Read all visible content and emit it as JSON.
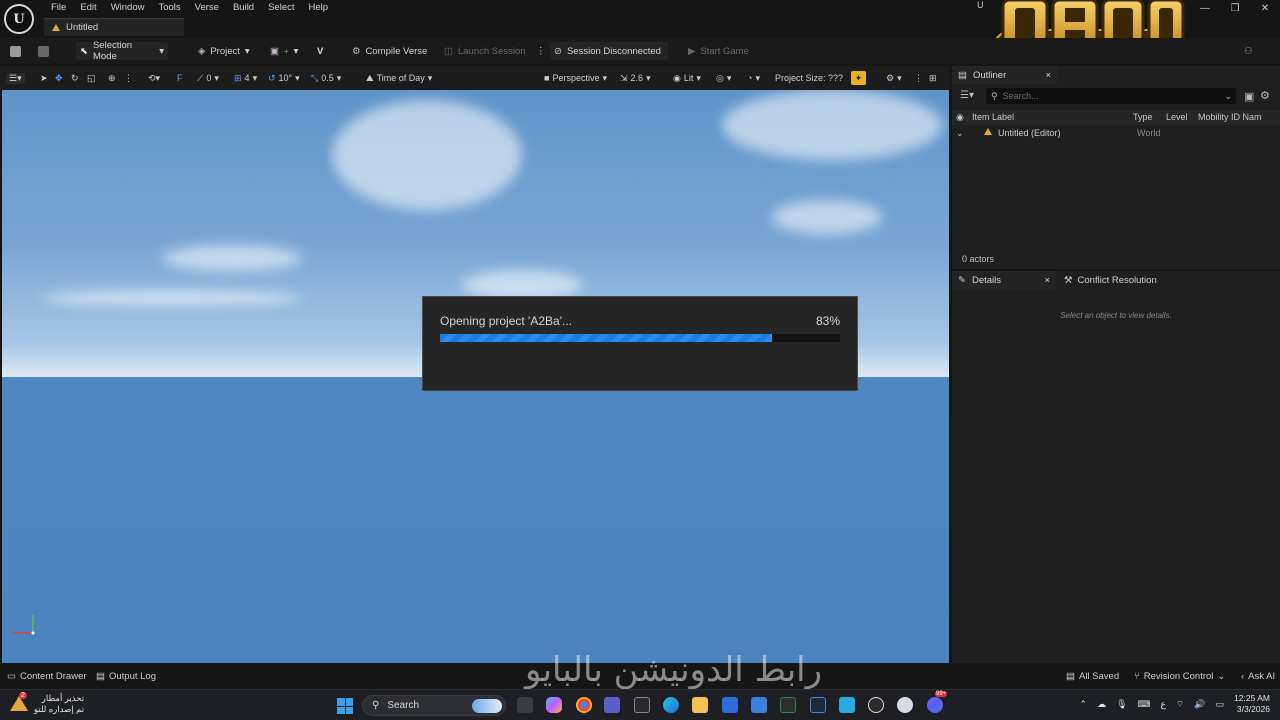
{
  "window": {
    "menu": [
      "File",
      "Edit",
      "Window",
      "Tools",
      "Verse",
      "Build",
      "Select",
      "Help"
    ],
    "doc_tab": "Untitled",
    "corner_letter": "U",
    "controls": [
      "—",
      "❐",
      "✕"
    ]
  },
  "toolbar": {
    "selection_mode": "Selection Mode",
    "project": "Project",
    "compile_verse": "Compile Verse",
    "launch_session": "Launch Session",
    "session_status": "Session Disconnected",
    "start_game": "Start Game"
  },
  "viewport_toolbar": {
    "snap_count": "0",
    "grid_snap": "4",
    "rotation_snap": "10°",
    "scale_snap": "0.5",
    "time_of_day": "Time of Day",
    "perspective": "Perspective",
    "camera_speed": "2.6",
    "lit": "Lit",
    "project_size": "Project Size: ???"
  },
  "loading_dialog": {
    "message": "Opening project 'A2Ba'...",
    "percent_label": "83%",
    "progress": 0.83
  },
  "outliner": {
    "tab_label": "Outliner",
    "close": "×",
    "search_placeholder": "Search...",
    "columns": [
      "Item Label",
      "Type",
      "Level",
      "Mobility",
      "ID Nam"
    ],
    "rows": [
      {
        "label": "Untitled (Editor)",
        "type": "World"
      }
    ],
    "actors_count": "0 actors"
  },
  "details": {
    "tab_label": "Details",
    "close": "×",
    "conflict_tab": "Conflict Resolution",
    "hint": "Select an object to view details."
  },
  "statusbar": {
    "content_drawer": "Content Drawer",
    "output_log": "Output Log",
    "all_saved": "All Saved",
    "revision_control": "Revision Control",
    "ask_ai": "Ask AI"
  },
  "watermark": "رابط الدونيشن بالبايو",
  "taskbar": {
    "weather_badge": "2",
    "weather_line1": "تحذير أمطار",
    "weather_line2": "تم إصداره للتو",
    "search_label": "Search",
    "lang": "ع",
    "time": "12:25 AM",
    "date": "3/3/2026",
    "chat_badge": "99+"
  },
  "colors": {
    "accent_blue": "#2a8cf0",
    "warning_orange": "#e6a83a",
    "logo_gold": "#e2a62a"
  }
}
